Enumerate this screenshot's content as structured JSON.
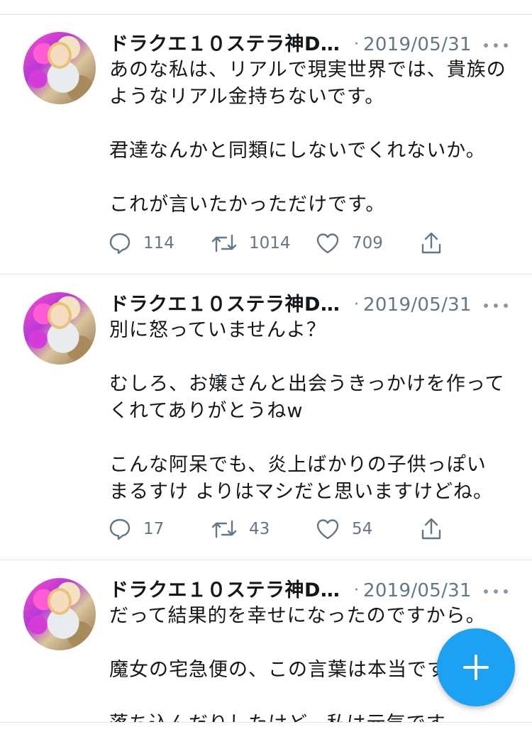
{
  "tweets": [
    {
      "author": "ドラクエ１０ステラ神D…",
      "separator": "·",
      "date": "2019/05/31",
      "lines": [
        "あのな私は、リアルで現実世界では、貴族の",
        "ようなリアル金持ちないです。",
        "",
        "君達なんかと同類にしないでくれないか。",
        "",
        "これが言いたかっただけです。"
      ],
      "replies": "114",
      "retweets": "1014",
      "likes": "709"
    },
    {
      "author": "ドラクエ１０ステラ神D…",
      "separator": "·",
      "date": "2019/05/31",
      "lines": [
        "別に怒っていませんよ？",
        "",
        "むしろ、お嬢さんと出会うきっかけを作って",
        "くれてありがとうねw",
        "",
        "こんな阿呆でも、炎上ばかりの子供っぽい",
        "まるすけ  よりはマシだと思いますけどね。"
      ],
      "replies": "17",
      "retweets": "43",
      "likes": "54"
    },
    {
      "author": "ドラクエ１０ステラ神D…",
      "separator": "·",
      "date": "2019/05/31",
      "lines": [
        "だって結果的を幸せになったのですから。",
        "",
        "魔女の宅急便の、この言葉は本当です",
        "",
        "落ち込んだりしたけど、私は元気です。"
      ]
    }
  ],
  "icons": {
    "reply": "reply-icon",
    "retweet": "retweet-icon",
    "like": "heart-icon",
    "share": "share-icon",
    "more": "more-dots-icon",
    "compose": "compose-plus-icon"
  },
  "colors": {
    "accent": "#1da1f2",
    "muted": "#657786",
    "divider": "#e1e6ea"
  }
}
